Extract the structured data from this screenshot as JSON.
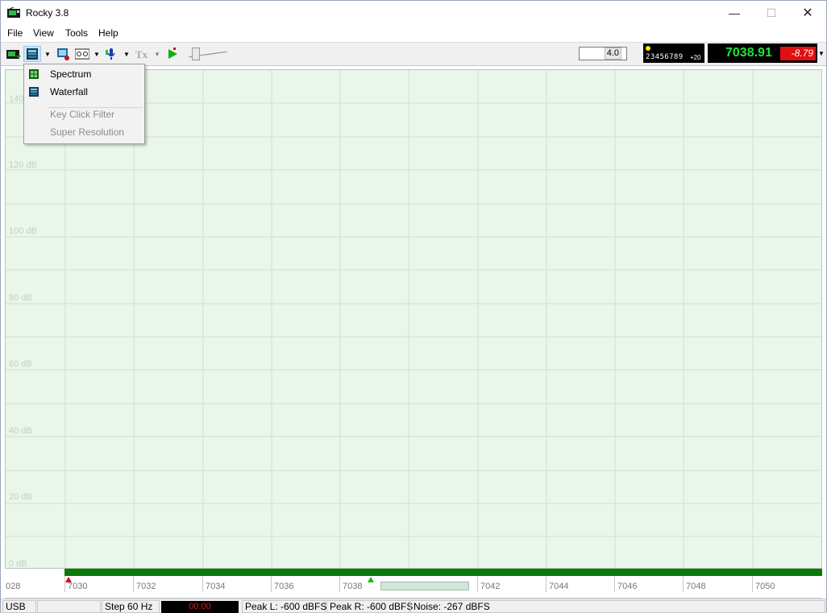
{
  "window": {
    "title": "Rocky 3.8"
  },
  "menu": [
    "File",
    "View",
    "Tools",
    "Help"
  ],
  "toolbar": {
    "value_input": "4.0",
    "led_digits": "23456789",
    "led_offset": "+20",
    "frequency": "7038.91",
    "frequency_offset": "-8.79"
  },
  "dropdown": {
    "items": [
      {
        "label": "Spectrum",
        "enabled": true,
        "icon": "spectrum-icon"
      },
      {
        "label": "Waterfall",
        "enabled": true,
        "icon": "waterfall-icon"
      },
      {
        "label": "Key Click Filter",
        "enabled": false
      },
      {
        "label": "Super Resolution",
        "enabled": false
      }
    ]
  },
  "plot": {
    "db_labels": [
      "140",
      "120 dB",
      "100 dB",
      "80 dB",
      "60 dB",
      "40 dB",
      "20 dB",
      "0 dB"
    ],
    "freq_labels": [
      "028",
      "7030",
      "7032",
      "7034",
      "7036",
      "7038",
      "7042",
      "7044",
      "7046",
      "7048",
      "7050"
    ]
  },
  "status": {
    "mode": "USB",
    "blank": "",
    "step": "Step 60 Hz",
    "timer": "00:00",
    "peak_l": "Peak L: -600 dBFS",
    "peak_r": "Peak R: -600 dBFS",
    "noise": "Noise: -267 dBFS"
  },
  "colors": {
    "plot_bg": "#e9f6e9",
    "frequency_green": "#22e03a",
    "offset_red": "#e01010",
    "bar_green": "#0a7a0a"
  }
}
